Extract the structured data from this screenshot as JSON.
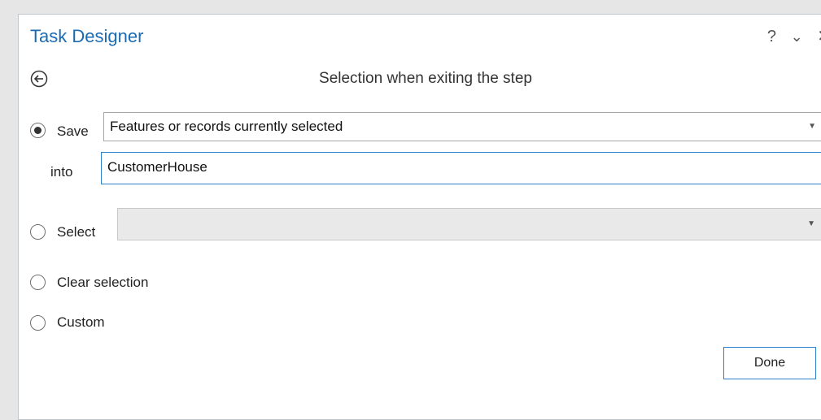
{
  "window": {
    "title": "Task Designer",
    "help_label": "?",
    "menu_label": "⌄",
    "close_label": "✕"
  },
  "step": {
    "subtitle": "Selection when exiting the step"
  },
  "options": {
    "save_label": "Save",
    "save_dropdown_value": "Features or records currently selected",
    "into_label": "into",
    "into_value": "CustomerHouse",
    "select_label": "Select",
    "select_dropdown_value": "",
    "clear_label": "Clear selection",
    "custom_label": "Custom",
    "selected_option": "Save"
  },
  "actions": {
    "done_label": "Done"
  },
  "colors": {
    "accent": "#1a6bb3",
    "focus_border": "#2f7fcf"
  }
}
